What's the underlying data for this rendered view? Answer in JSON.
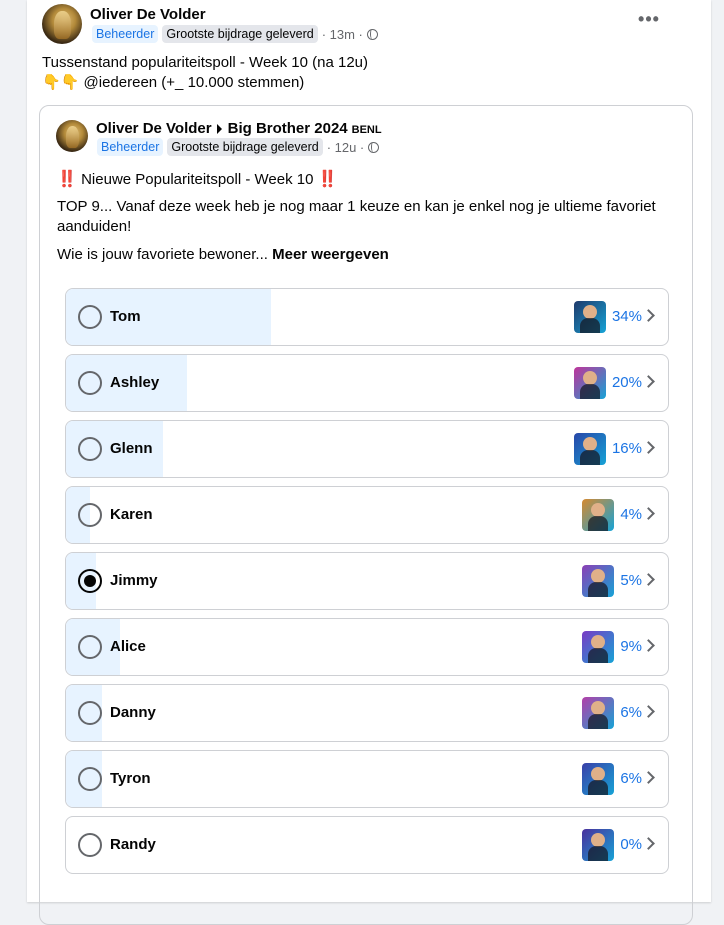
{
  "post": {
    "author": "Oliver De Volder",
    "badge_admin": "Beheerder",
    "badge_contributor": "Grootste bijdrage geleverd",
    "time": "· 13m ·",
    "line1": "Tussenstand populariteitspoll - Week 10 (na 12u)",
    "line2_emoji": "👇👇",
    "line2": "@iedereen (+_ 10.000 stemmen)"
  },
  "shared": {
    "author": "Oliver De Volder",
    "group": "Big Brother 2024",
    "group_suffix": "BENL",
    "badge_admin": "Beheerder",
    "badge_contributor": "Grootste bijdrage geleverd",
    "time": "· 12u ·",
    "title_mark": "‼️",
    "title": "Nieuwe Populariteitspoll - Week 10",
    "body": "TOP 9... Vanaf deze week heb je nog maar 1 keuze en kan je enkel nog je ultieme favoriet aanduiden!",
    "question": "Wie is  jouw favoriete bewoner...",
    "see_more": "Meer weergeven"
  },
  "poll": {
    "options": [
      {
        "label": "Tom",
        "percent_text": "34%",
        "fill": 0.34,
        "selected": false,
        "thumb_color": "#1f3a6b"
      },
      {
        "label": "Ashley",
        "percent_text": "20%",
        "fill": 0.2,
        "selected": false,
        "thumb_color": "#c0349a"
      },
      {
        "label": "Glenn",
        "percent_text": "16%",
        "fill": 0.16,
        "selected": false,
        "thumb_color": "#2846a8"
      },
      {
        "label": "Karen",
        "percent_text": "4%",
        "fill": 0.04,
        "selected": false,
        "thumb_color": "#d6892f"
      },
      {
        "label": "Jimmy",
        "percent_text": "5%",
        "fill": 0.05,
        "selected": true,
        "thumb_color": "#8c3fb5"
      },
      {
        "label": "Alice",
        "percent_text": "9%",
        "fill": 0.09,
        "selected": false,
        "thumb_color": "#7a3bc4"
      },
      {
        "label": "Danny",
        "percent_text": "6%",
        "fill": 0.06,
        "selected": false,
        "thumb_color": "#b43fa8"
      },
      {
        "label": "Tyron",
        "percent_text": "6%",
        "fill": 0.06,
        "selected": false,
        "thumb_color": "#3a3fa8"
      },
      {
        "label": "Randy",
        "percent_text": "0%",
        "fill": 0.0,
        "selected": false,
        "thumb_color": "#4a2f9c"
      }
    ]
  },
  "colors": {
    "accent": "#1b74e4",
    "poll_fill": "#e7f3ff"
  }
}
